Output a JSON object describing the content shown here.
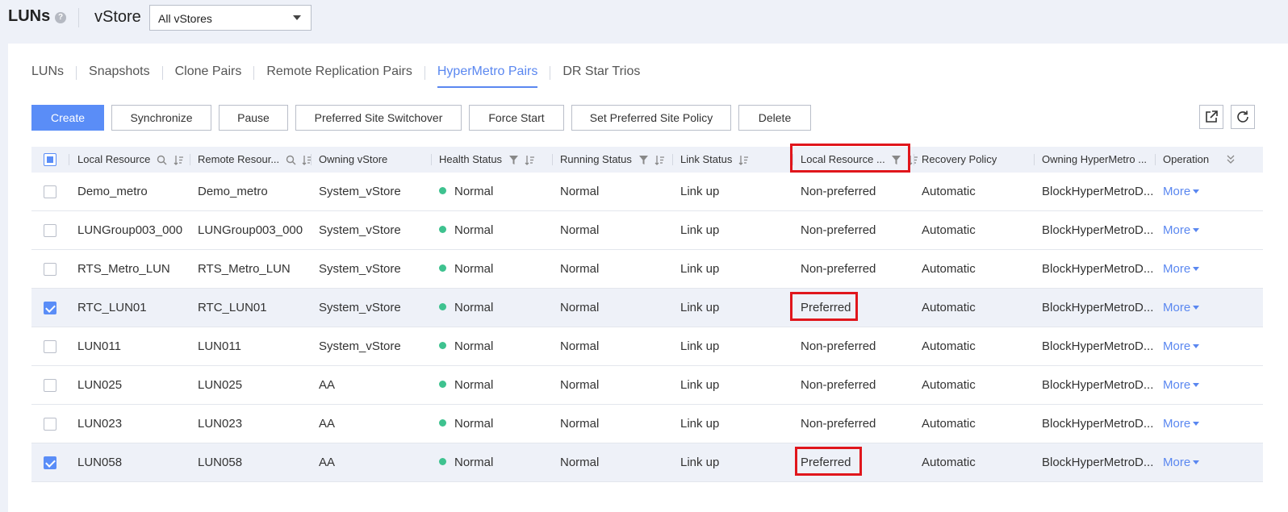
{
  "header": {
    "title": "LUNs",
    "vstore_label": "vStore",
    "vstore_selected": "All vStores"
  },
  "tabs": [
    "LUNs",
    "Snapshots",
    "Clone Pairs",
    "Remote Replication Pairs",
    "HyperMetro Pairs",
    "DR Star Trios"
  ],
  "active_tab": "HyperMetro Pairs",
  "toolbar": {
    "create": "Create",
    "synchronize": "Synchronize",
    "pause": "Pause",
    "preferred_site_switchover": "Preferred Site Switchover",
    "force_start": "Force Start",
    "set_preferred_site_policy": "Set Preferred Site Policy",
    "delete": "Delete"
  },
  "columns": {
    "local_resource": "Local Resource",
    "remote_resource": "Remote Resour...",
    "owning_vstore": "Owning vStore",
    "health_status": "Health Status",
    "running_status": "Running Status",
    "link_status": "Link Status",
    "local_resource_role": "Local Resource ...",
    "recovery_policy": "Recovery Policy",
    "owning_hypermetro": "Owning HyperMetro ...",
    "operation": "Operation"
  },
  "rows": [
    {
      "local": "Demo_metro",
      "remote": "Demo_metro",
      "vstore": "System_vStore",
      "health": "Normal",
      "running": "Normal",
      "link": "Link up",
      "role": "Non-preferred",
      "recovery": "Automatic",
      "domain": "BlockHyperMetroD...",
      "op": "More",
      "checked": false
    },
    {
      "local": "LUNGroup003_000",
      "remote": "LUNGroup003_000",
      "vstore": "System_vStore",
      "health": "Normal",
      "running": "Normal",
      "link": "Link up",
      "role": "Non-preferred",
      "recovery": "Automatic",
      "domain": "BlockHyperMetroD...",
      "op": "More",
      "checked": false
    },
    {
      "local": "RTS_Metro_LUN",
      "remote": "RTS_Metro_LUN",
      "vstore": "System_vStore",
      "health": "Normal",
      "running": "Normal",
      "link": "Link up",
      "role": "Non-preferred",
      "recovery": "Automatic",
      "domain": "BlockHyperMetroD...",
      "op": "More",
      "checked": false
    },
    {
      "local": "RTC_LUN01",
      "remote": "RTC_LUN01",
      "vstore": "System_vStore",
      "health": "Normal",
      "running": "Normal",
      "link": "Link up",
      "role": "Preferred",
      "recovery": "Automatic",
      "domain": "BlockHyperMetroD...",
      "op": "More",
      "checked": true
    },
    {
      "local": "LUN011",
      "remote": "LUN011",
      "vstore": "System_vStore",
      "health": "Normal",
      "running": "Normal",
      "link": "Link up",
      "role": "Non-preferred",
      "recovery": "Automatic",
      "domain": "BlockHyperMetroD...",
      "op": "More",
      "checked": false
    },
    {
      "local": "LUN025",
      "remote": "LUN025",
      "vstore": "AA",
      "health": "Normal",
      "running": "Normal",
      "link": "Link up",
      "role": "Non-preferred",
      "recovery": "Automatic",
      "domain": "BlockHyperMetroD...",
      "op": "More",
      "checked": false
    },
    {
      "local": "LUN023",
      "remote": "LUN023",
      "vstore": "AA",
      "health": "Normal",
      "running": "Normal",
      "link": "Link up",
      "role": "Non-preferred",
      "recovery": "Automatic",
      "domain": "BlockHyperMetroD...",
      "op": "More",
      "checked": false
    },
    {
      "local": "LUN058",
      "remote": "LUN058",
      "vstore": "AA",
      "health": "Normal",
      "running": "Normal",
      "link": "Link up",
      "role": "Preferred",
      "recovery": "Automatic",
      "domain": "BlockHyperMetroD...",
      "op": "More",
      "checked": true
    }
  ],
  "colors": {
    "accent": "#5a8df7",
    "status_normal": "#3ec28f",
    "highlight": "#e0161c"
  }
}
